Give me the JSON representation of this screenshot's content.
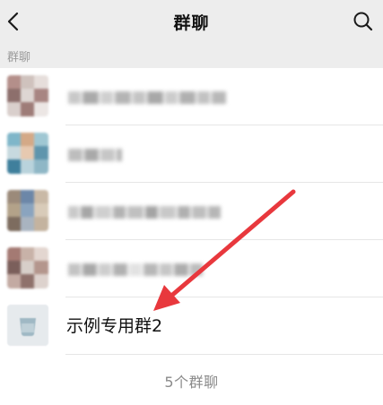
{
  "header": {
    "title": "群聊",
    "back_icon": "chevron-left-icon",
    "search_icon": "search-icon"
  },
  "section": {
    "label": "群聊"
  },
  "groups": [
    {
      "name": "",
      "blurred": true,
      "avatar_colors": [
        "#b48f8a",
        "#cfc2bd",
        "#e6dedb",
        "#8d6f6c",
        "#ded6d3",
        "#a88582"
      ]
    },
    {
      "name": "",
      "blurred": true,
      "avatar_colors": [
        "#7fb6c9",
        "#d4a987",
        "#9fc7d3",
        "#c7d9df",
        "#e7c9b0",
        "#5f95ad"
      ]
    },
    {
      "name": "",
      "blurred": true,
      "avatar_colors": [
        "#9b8a7a",
        "#6c87a8",
        "#c9b9a6",
        "#b3a289",
        "#8aa4bf",
        "#d8cbb9"
      ]
    },
    {
      "name": "",
      "blurred": true,
      "avatar_colors": [
        "#a47a73",
        "#c8b2a8",
        "#e3d6d0",
        "#7b5f5b",
        "#d7cfc9",
        "#b4968d"
      ]
    },
    {
      "name": "示例专用群2",
      "blurred": false,
      "avatar_colors": [
        "#e8ecef",
        "#9fb8c4",
        "#bfd0d8"
      ]
    }
  ],
  "footer": {
    "count_text": "5个群聊"
  },
  "annotation": {
    "arrow_color": "#e8383d"
  }
}
